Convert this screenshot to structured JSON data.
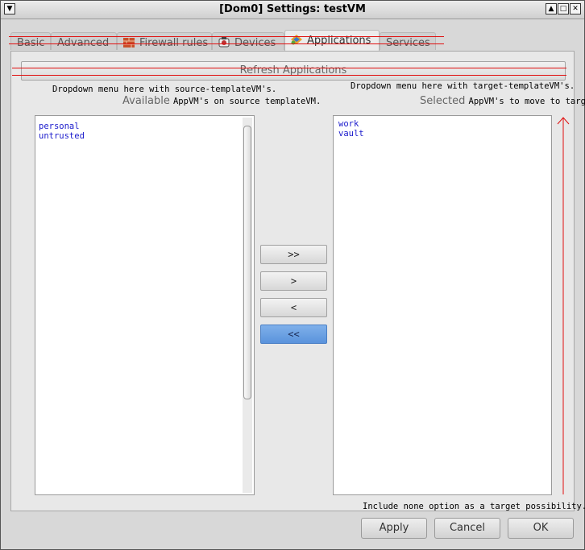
{
  "window": {
    "title": "[Dom0] Settings: testVM"
  },
  "tabs": [
    {
      "label": "Basic"
    },
    {
      "label": "Advanced"
    },
    {
      "label": "Firewall rules"
    },
    {
      "label": "Devices"
    },
    {
      "label": "Applications",
      "active": true
    },
    {
      "label": "Services"
    }
  ],
  "refresh_label": "Refresh Applications",
  "source": {
    "note": "Dropdown menu here with source-templateVM's.",
    "heading_gray": "Available",
    "heading_rest": "AppVM's on source templateVM.",
    "items": [
      "personal",
      "untrusted"
    ]
  },
  "target": {
    "note": "Dropdown menu here with target-templateVM's.",
    "heading_gray": "Selected",
    "heading_rest": "AppVM's to move to targ.",
    "items": [
      "work",
      "vault"
    ],
    "footer_note": "Include none option as a target possibility."
  },
  "move_buttons": {
    "all_right": ">>",
    "right": ">",
    "left": "<",
    "all_left": "<<"
  },
  "dialog_buttons": {
    "apply": "Apply",
    "cancel": "Cancel",
    "ok": "OK"
  },
  "colors": {
    "annotation": "#e01010",
    "selected_button": "#5a93dc",
    "list_text": "#1a1acc"
  }
}
